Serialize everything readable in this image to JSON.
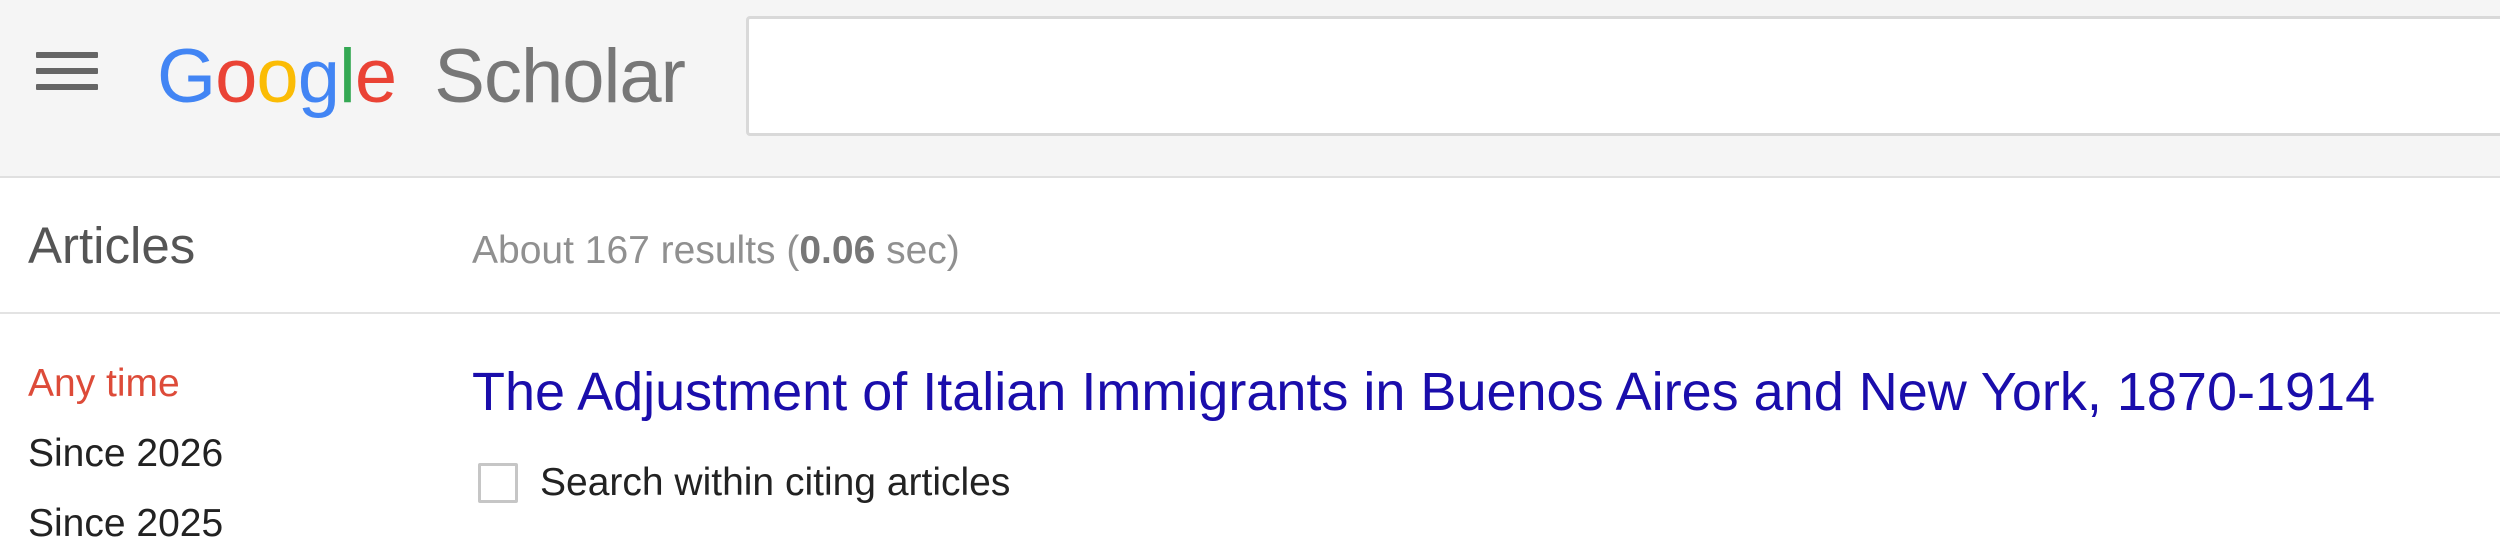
{
  "header": {
    "menu_icon": "hamburger-menu-icon",
    "logo": {
      "google_letters": [
        {
          "char": "G",
          "color": "#4285F4"
        },
        {
          "char": "o",
          "color": "#EA4335"
        },
        {
          "char": "o",
          "color": "#FBBC05"
        },
        {
          "char": "g",
          "color": "#4285F4"
        },
        {
          "char": "l",
          "color": "#34A853"
        },
        {
          "char": "e",
          "color": "#EA4335"
        }
      ],
      "product": "Scholar"
    },
    "search": {
      "value": "",
      "placeholder": ""
    }
  },
  "subbar": {
    "section_title": "Articles",
    "stats_prefix": "About 167 results (",
    "stats_time": "0.06",
    "stats_suffix": " sec)"
  },
  "sidebar": {
    "time_filters": [
      {
        "label": "Any time",
        "active": true
      },
      {
        "label": "Since 2026",
        "active": false
      },
      {
        "label": "Since 2025",
        "active": false
      }
    ]
  },
  "results": [
    {
      "title": "The Adjustment of Italian Immigrants in Buenos Aires and New York, 1870-1914"
    }
  ],
  "citing": {
    "checked": false,
    "label": "Search within citing articles"
  },
  "colors": {
    "active_filter": "#dd4b39",
    "result_link": "#1a0dab",
    "header_bg": "#f5f5f5"
  }
}
